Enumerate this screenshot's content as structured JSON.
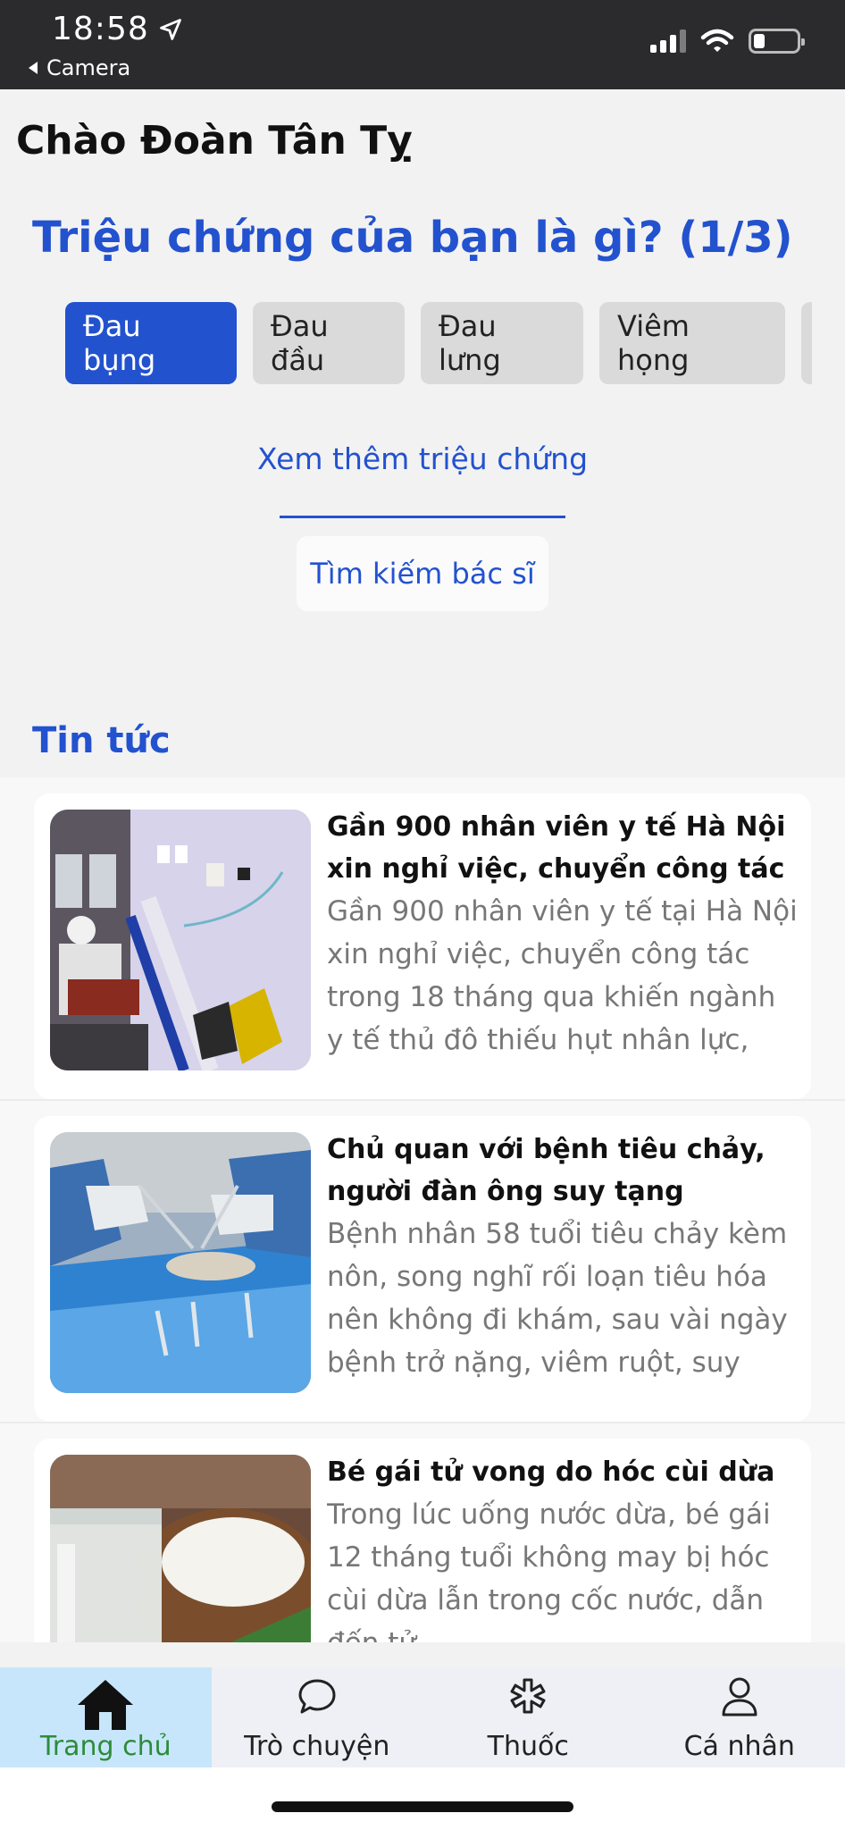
{
  "status_bar": {
    "time": "18:58",
    "back_label": "Camera"
  },
  "greeting": "Chào Đoàn Tân Tỵ",
  "symptom_question": "Triệu chứng của bạn là gì? (1/3)",
  "symptoms": [
    "Đau bụng",
    "Đau đầu",
    "Đau lưng",
    "Viêm họng"
  ],
  "selected_symptom": "Đau bụng",
  "see_more": "Xem thêm triệu chứng",
  "find_doctor": "Tìm kiếm bác sĩ",
  "news_title": "Tin tức",
  "news": [
    {
      "title": "Gần 900 nhân viên y tế Hà Nội xin nghỉ việc, chuyển công tác",
      "description": "Gần 900 nhân viên y tế tại Hà Nội xin nghỉ việc, chuyển công tác trong 18 tháng qua khiến ngành y tế thủ đô thiếu hụt nhân lực, ảnh..."
    },
    {
      "title": "Chủ quan với bệnh tiêu chảy, người đàn ông suy tạng",
      "description": "Bệnh nhân 58 tuổi tiêu chảy kèm nôn, song nghĩ rối loạn tiêu hóa nên không đi khám, sau vài ngày bệnh trở nặng, viêm ruột, suy đa..."
    },
    {
      "title": "Bé gái tử vong do hóc cùi dừa",
      "description": "Trong lúc uống nước dừa, bé gái 12 tháng tuổi không may bị hóc cùi dừa lẫn trong cốc nước, dẫn đến tử"
    }
  ],
  "tabs": [
    {
      "label": "Trang chủ",
      "icon": "home-icon"
    },
    {
      "label": "Trò chuyện",
      "icon": "chat-icon"
    },
    {
      "label": "Thuốc",
      "icon": "medicine-icon"
    },
    {
      "label": "Cá nhân",
      "icon": "person-icon"
    }
  ],
  "active_tab": "Trang chủ",
  "colors": {
    "accent": "#2352cf",
    "active_tab_bg": "#c7e6fb",
    "active_tab_text": "#2e8b3a"
  }
}
